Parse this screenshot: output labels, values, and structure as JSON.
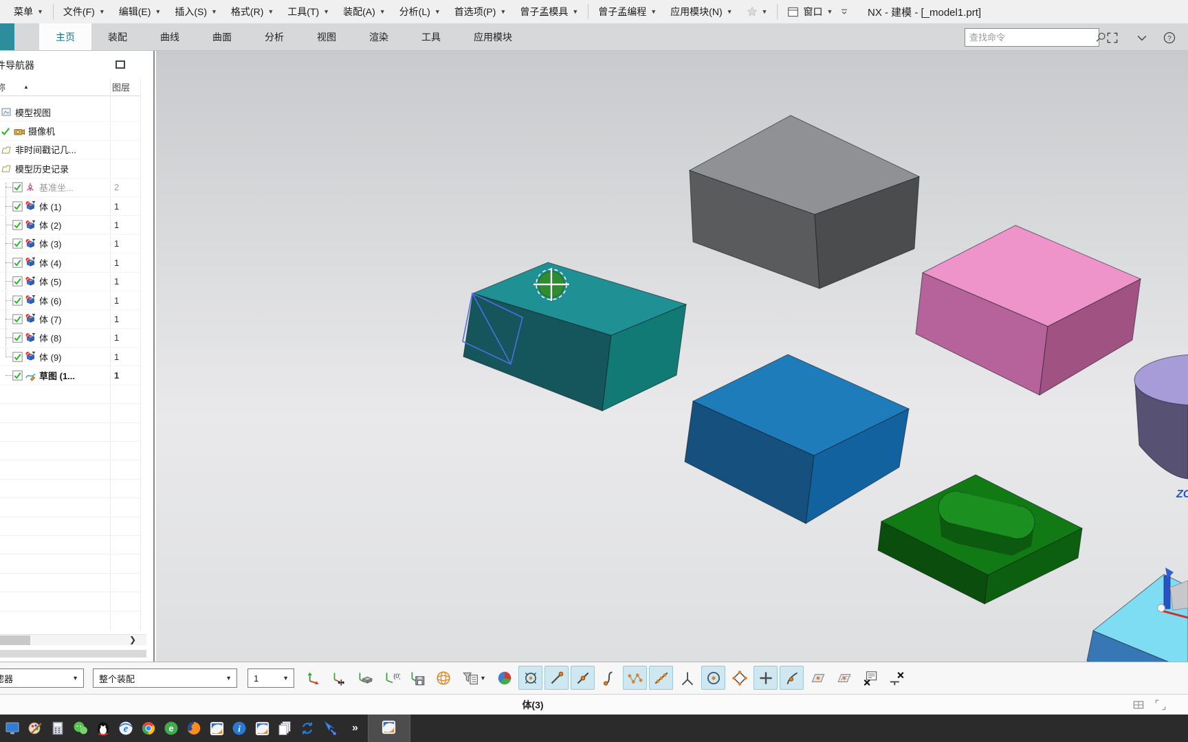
{
  "window": {
    "title": "NX - 建模 - [_model1.prt]"
  },
  "menubar": {
    "items": [
      {
        "label": "菜单",
        "caret": true,
        "sep": true
      },
      {
        "label": "文件(F)",
        "caret": true
      },
      {
        "label": "编辑(E)",
        "caret": true
      },
      {
        "label": "插入(S)",
        "caret": true
      },
      {
        "label": "格式(R)",
        "caret": true
      },
      {
        "label": "工具(T)",
        "caret": true
      },
      {
        "label": "装配(A)",
        "caret": true
      },
      {
        "label": "分析(L)",
        "caret": true
      },
      {
        "label": "首选项(P)",
        "caret": true
      },
      {
        "label": "曾子孟模具",
        "caret": true,
        "sep": true
      },
      {
        "label": "曾子孟编程",
        "caret": true
      },
      {
        "label": "应用模块(N)",
        "caret": true
      }
    ],
    "window_menu": {
      "label": "窗口"
    }
  },
  "ribbon": {
    "tabs": [
      {
        "label": "主页",
        "active": true
      },
      {
        "label": "装配"
      },
      {
        "label": "曲线"
      },
      {
        "label": "曲面"
      },
      {
        "label": "分析"
      },
      {
        "label": "视图"
      },
      {
        "label": "渲染"
      },
      {
        "label": "工具"
      },
      {
        "label": "应用模块"
      }
    ],
    "search": {
      "placeholder": "查找命令"
    }
  },
  "navigator": {
    "title": "导航器",
    "title_clipped_prefix": "件",
    "columns": {
      "name_clipped": "称",
      "layer": "图层"
    },
    "rows": [
      {
        "label": "模型视图",
        "icon": "model-view",
        "type": "parent"
      },
      {
        "label": "摄像机",
        "icon": "camera",
        "type": "parent",
        "precheck": true
      },
      {
        "label": "非时间戳记几...",
        "icon": "folder",
        "type": "parent"
      },
      {
        "label": "模型历史记录",
        "icon": "folder",
        "type": "parent"
      },
      {
        "label": "基准坐...",
        "icon": "datum-csys",
        "checked": true,
        "layer": "2",
        "dim": true
      },
      {
        "label": "体 (1)",
        "icon": "body",
        "checked": true,
        "layer": "1"
      },
      {
        "label": "体 (2)",
        "icon": "body",
        "checked": true,
        "layer": "1"
      },
      {
        "label": "体 (3)",
        "icon": "body",
        "checked": true,
        "layer": "1"
      },
      {
        "label": "体 (4)",
        "icon": "body",
        "checked": true,
        "layer": "1"
      },
      {
        "label": "体 (5)",
        "icon": "body",
        "checked": true,
        "layer": "1"
      },
      {
        "label": "体 (6)",
        "icon": "body",
        "checked": true,
        "layer": "1"
      },
      {
        "label": "体 (7)",
        "icon": "body",
        "checked": true,
        "layer": "1"
      },
      {
        "label": "体 (8)",
        "icon": "body",
        "checked": true,
        "layer": "1"
      },
      {
        "label": "体 (9)",
        "icon": "body",
        "checked": true,
        "layer": "1"
      },
      {
        "label": "草图 (1...",
        "icon": "sketch",
        "checked": true,
        "layer": "1",
        "bold": true
      }
    ]
  },
  "toolbar": {
    "filter_dropdown": {
      "value": "滤器",
      "clipped": true
    },
    "scope_dropdown": {
      "value": "整个装配"
    },
    "layer_dropdown": {
      "value": "1"
    },
    "icons": [
      {
        "name": "csys-orient",
        "hl": false
      },
      {
        "name": "csys-dynamic",
        "hl": false
      },
      {
        "name": "csys-solid",
        "hl": false
      },
      {
        "name": "csys-absolute",
        "hl": false
      },
      {
        "name": "csys-save",
        "hl": false
      },
      {
        "name": "wcs-display",
        "hl": false
      },
      {
        "name": "type-filter",
        "hl": false,
        "caret": true
      },
      {
        "name": "color-filter-pie",
        "hl": false
      },
      {
        "name": "snap-point",
        "hl": true
      },
      {
        "name": "snap-endpoint",
        "hl": true
      },
      {
        "name": "snap-midpoint",
        "hl": true
      },
      {
        "name": "snap-tangent",
        "hl": false
      },
      {
        "name": "snap-pole",
        "hl": true
      },
      {
        "name": "snap-point-on-line",
        "hl": true
      },
      {
        "name": "snap-intersection",
        "hl": false
      },
      {
        "name": "snap-arc-center",
        "hl": true
      },
      {
        "name": "snap-quadrant",
        "hl": false
      },
      {
        "name": "snap-existing-point",
        "hl": true
      },
      {
        "name": "snap-point-on-curve",
        "hl": true
      },
      {
        "name": "snap-point-on-face",
        "hl": false
      },
      {
        "name": "snap-bounded-grid",
        "hl": false
      },
      {
        "name": "snap-dialog",
        "hl": false
      },
      {
        "name": "snap-clear",
        "hl": false
      }
    ]
  },
  "statusbar": {
    "message": "体(3)"
  },
  "viewport": {
    "zc_label": "ZC",
    "zc_color": "#2456c6",
    "selected_body": "teal_box",
    "cursor": {
      "type": "snap-crosshair",
      "disc": "#2f8c31",
      "ring": "#ffffff"
    },
    "objects": {
      "gray_box": {
        "top": "#8f9194",
        "left": "#5a5b5d",
        "right": "#4b4c4e"
      },
      "teal_box": {
        "top": "#1f9093",
        "left": "#14565c",
        "right": "#117a74",
        "sketch": "#4d6fe3"
      },
      "pink_box": {
        "top": "#ef93cb",
        "left": "#b5639a",
        "right": "#a05383"
      },
      "blue_box": {
        "top": "#1e7cbb",
        "left": "#15507e",
        "right": "#12629f"
      },
      "green_plate": {
        "top": "#117a14",
        "left": "#0a4d0d",
        "right": "#0d5f10",
        "boss_top": "#1b8f1f",
        "boss_side": "#0c5a0f"
      },
      "purple_cylinder": {
        "top": "#a89cd8",
        "side": "#575173"
      },
      "cyan_box": {
        "top": "#7eddf2",
        "front": "#3877b5"
      },
      "manipulator": {
        "post": "#2a52c8",
        "plate": "#c8c8cc",
        "rod": "#d03030",
        "ball": "#f6f6f6"
      }
    }
  },
  "taskbar": {
    "overflow": "»",
    "icons": [
      "desktop",
      "paint",
      "calculator",
      "wechat",
      "qq",
      "ie",
      "chrome",
      "browser-360",
      "firefox",
      "nx",
      "info",
      "nx-2",
      "documents",
      "sync",
      "cursor-tool"
    ],
    "active": "nx"
  }
}
